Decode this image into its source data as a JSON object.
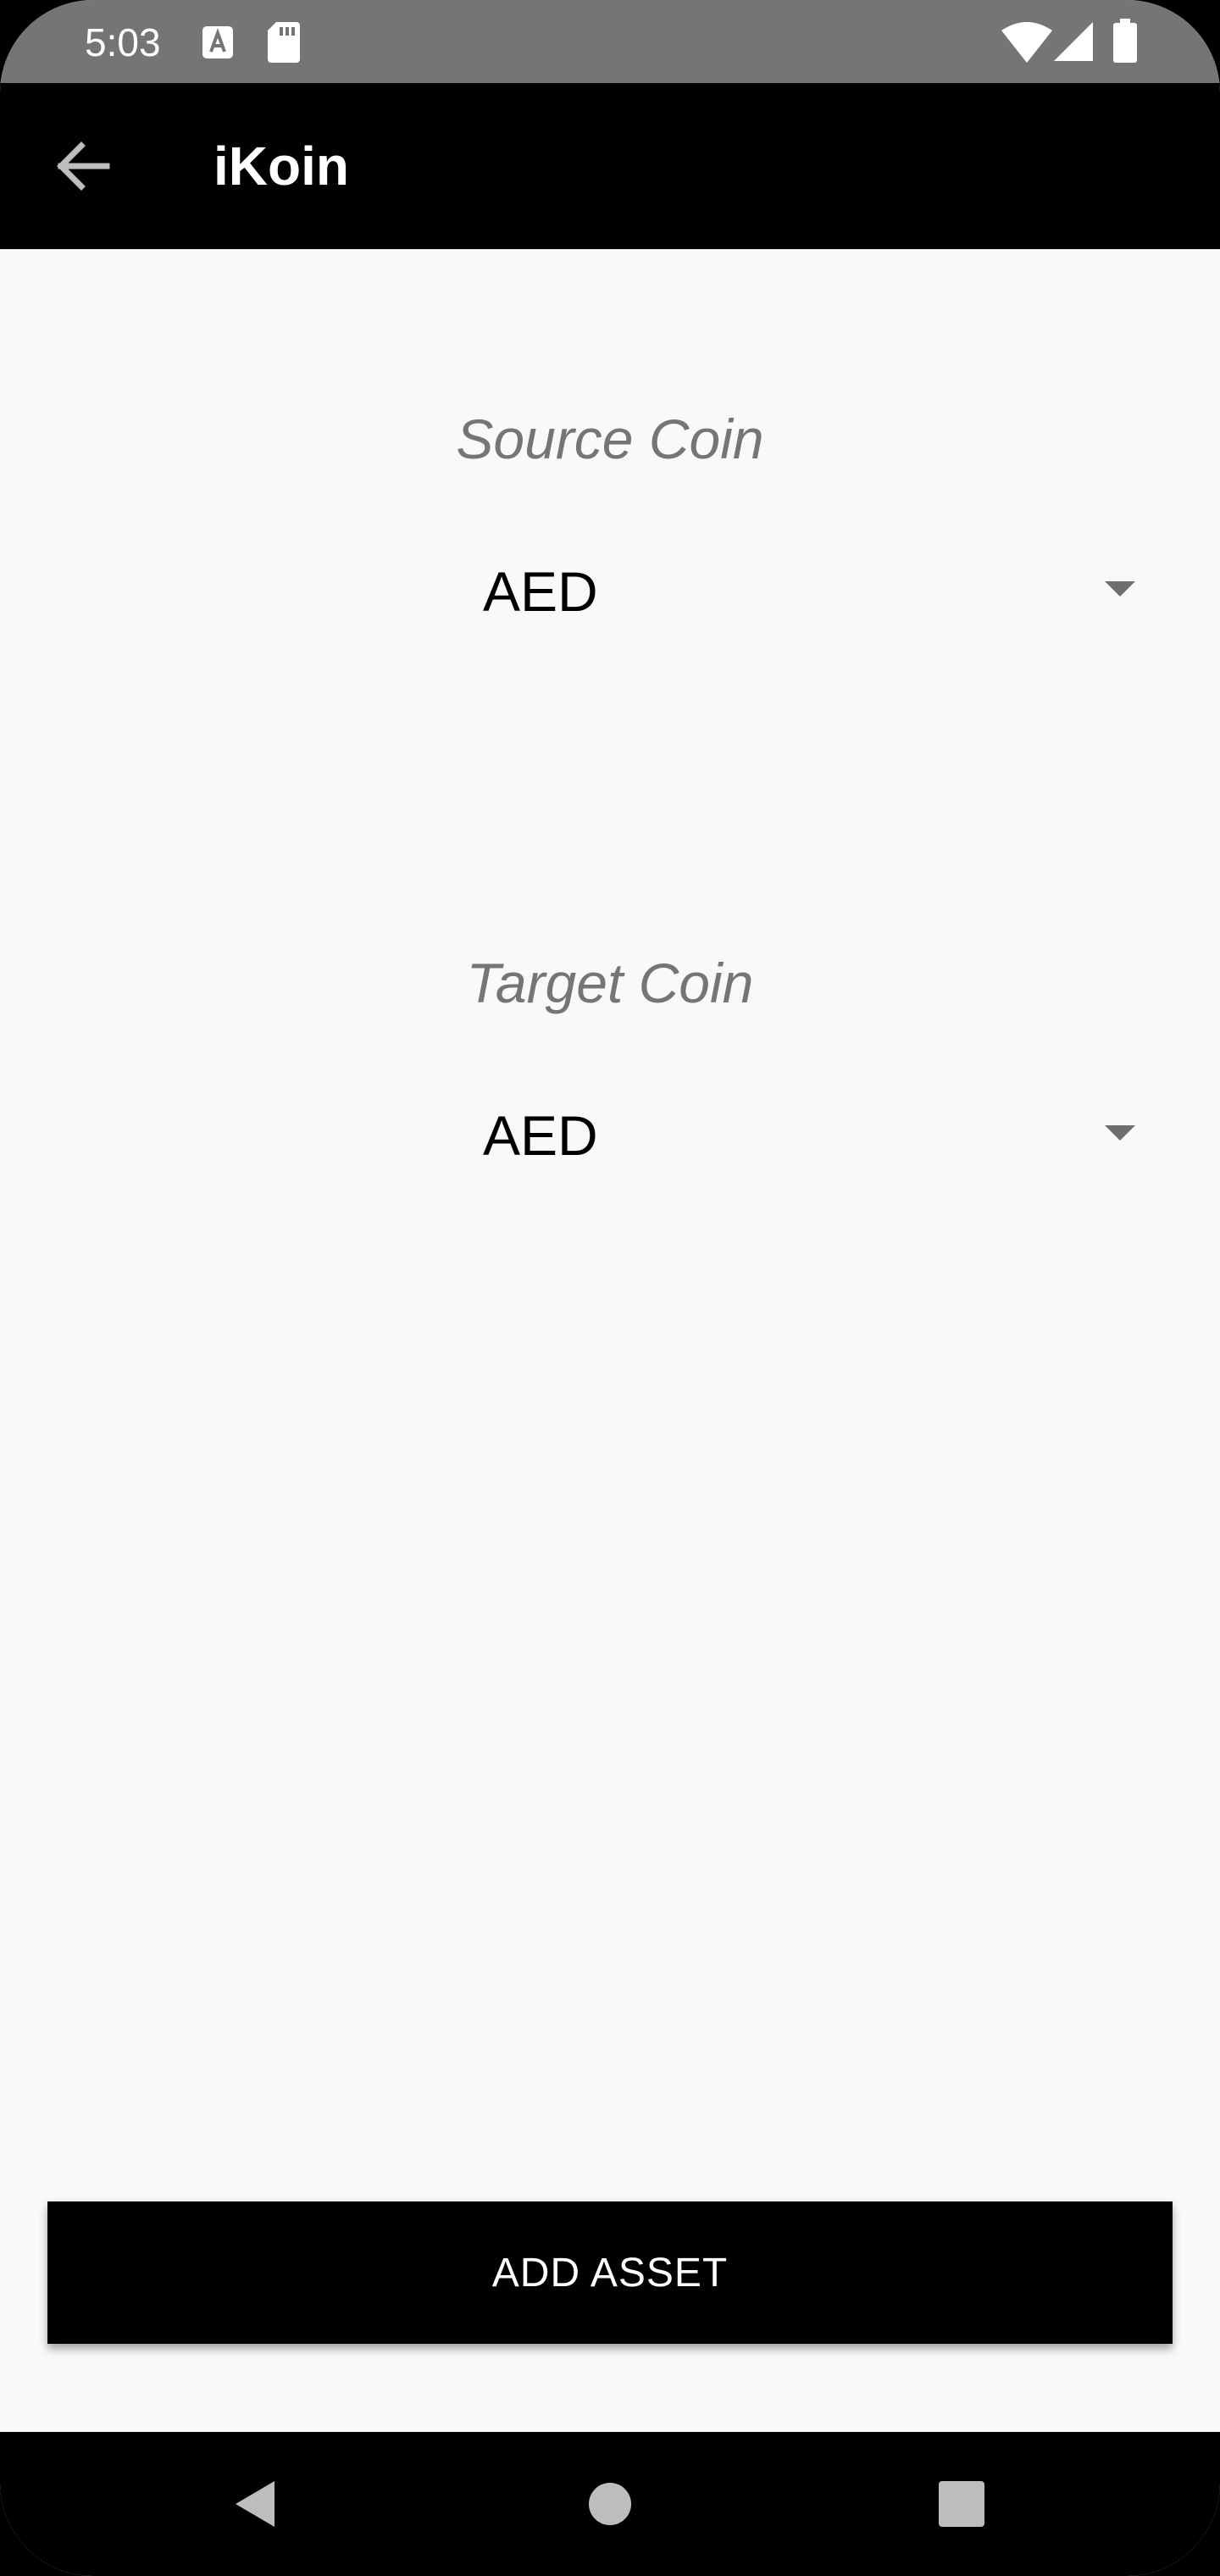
{
  "status_bar": {
    "time": "5:03",
    "icons": [
      "notification-a-icon",
      "sd-card-icon",
      "wifi-icon",
      "cellular-signal-icon",
      "battery-icon"
    ],
    "background": "#757575"
  },
  "app_bar": {
    "title": "iKoin",
    "back_icon": "arrow-back-icon",
    "background": "#000000"
  },
  "source": {
    "label": "Source Coin",
    "selected": "AED"
  },
  "target": {
    "label": "Target Coin",
    "selected": "AED"
  },
  "actions": {
    "add_asset_label": "ADD ASSET"
  },
  "nav_bar": {
    "icons": [
      "nav-back-icon",
      "nav-home-icon",
      "nav-recents-icon"
    ]
  },
  "colors": {
    "accent": "#000000",
    "label": "#757575",
    "background": "#f9f9f9"
  }
}
